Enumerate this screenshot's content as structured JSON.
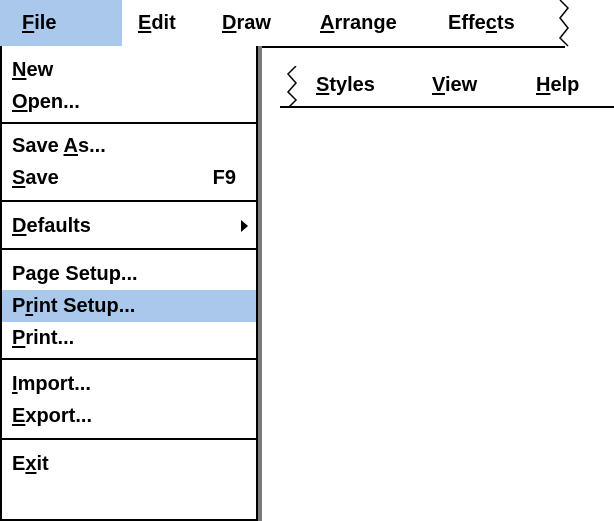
{
  "menubar": {
    "items": [
      {
        "pre": "",
        "u": "F",
        "post": "ile"
      },
      {
        "pre": "",
        "u": "E",
        "post": "dit"
      },
      {
        "pre": "",
        "u": "D",
        "post": "raw"
      },
      {
        "pre": "",
        "u": "A",
        "post": "rrange"
      },
      {
        "pre": "Effe",
        "u": "c",
        "post": "ts"
      }
    ],
    "overflow_items": [
      {
        "pre": "",
        "u": "S",
        "post": "tyles"
      },
      {
        "pre": "",
        "u": "V",
        "post": "iew"
      },
      {
        "pre": "",
        "u": "H",
        "post": "elp"
      }
    ]
  },
  "file_menu": {
    "items": [
      {
        "pre": "",
        "u": "N",
        "post": "ew",
        "accel": ""
      },
      {
        "pre": "",
        "u": "O",
        "post": "pen...",
        "accel": ""
      },
      {
        "pre": "Save ",
        "u": "A",
        "post": "s...",
        "accel": ""
      },
      {
        "pre": "",
        "u": "S",
        "post": "ave",
        "accel": "F9"
      },
      {
        "pre": "",
        "u": "D",
        "post": "efaults",
        "accel": ""
      },
      {
        "pre": "Page Setup...",
        "u": "",
        "post": "",
        "accel": ""
      },
      {
        "pre": "P",
        "u": "r",
        "post": "int Setup...",
        "accel": ""
      },
      {
        "pre": "",
        "u": "P",
        "post": "rint...",
        "accel": ""
      },
      {
        "pre": "",
        "u": "I",
        "post": "mport...",
        "accel": ""
      },
      {
        "pre": "",
        "u": "E",
        "post": "xport...",
        "accel": ""
      },
      {
        "pre": "E",
        "u": "x",
        "post": "it",
        "accel": ""
      }
    ]
  },
  "colors": {
    "highlight": "#a9c8ec",
    "shadow": "#7a7a7a"
  }
}
